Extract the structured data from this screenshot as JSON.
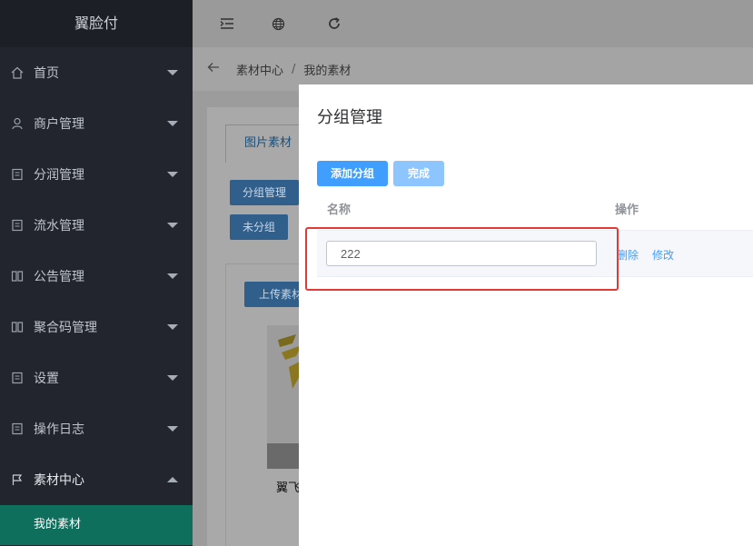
{
  "app": {
    "title": "翼脸付"
  },
  "sidebar": {
    "items": [
      {
        "label": "首页",
        "icon": "home-icon"
      },
      {
        "label": "商户管理",
        "icon": "user-icon"
      },
      {
        "label": "分润管理",
        "icon": "document-icon"
      },
      {
        "label": "流水管理",
        "icon": "document-icon"
      },
      {
        "label": "公告管理",
        "icon": "notice-icon"
      },
      {
        "label": "聚合码管理",
        "icon": "notice-icon"
      },
      {
        "label": "设置",
        "icon": "document-icon"
      },
      {
        "label": "操作日志",
        "icon": "document-icon"
      },
      {
        "label": "素材中心",
        "icon": "flag-icon",
        "expanded": true
      }
    ],
    "subitem": {
      "label": "我的素材"
    },
    "active_color": "#0e6f5c"
  },
  "topbar": {
    "icons": [
      "menu-fold-icon",
      "globe-icon",
      "refresh-icon"
    ]
  },
  "breadcrumb": {
    "back_icon": "arrow-left-icon",
    "parent": "素材中心",
    "separator": "/",
    "current": "我的素材"
  },
  "background_page": {
    "tab_label": "图片素材",
    "group_manage_button": "分组管理",
    "ungrouped_button": "未分组",
    "upload_button": "上传素材",
    "thumb_caption": "翼飞"
  },
  "modal": {
    "title": "分组管理",
    "add_group_button": "添加分组",
    "done_button": "完成",
    "columns": {
      "name": "名称",
      "operation": "操作"
    },
    "rows": [
      {
        "name_value": "222",
        "delete_label": "删除",
        "edit_label": "修改"
      }
    ],
    "accent_color": "#409eff",
    "highlight_color": "#e53935"
  }
}
